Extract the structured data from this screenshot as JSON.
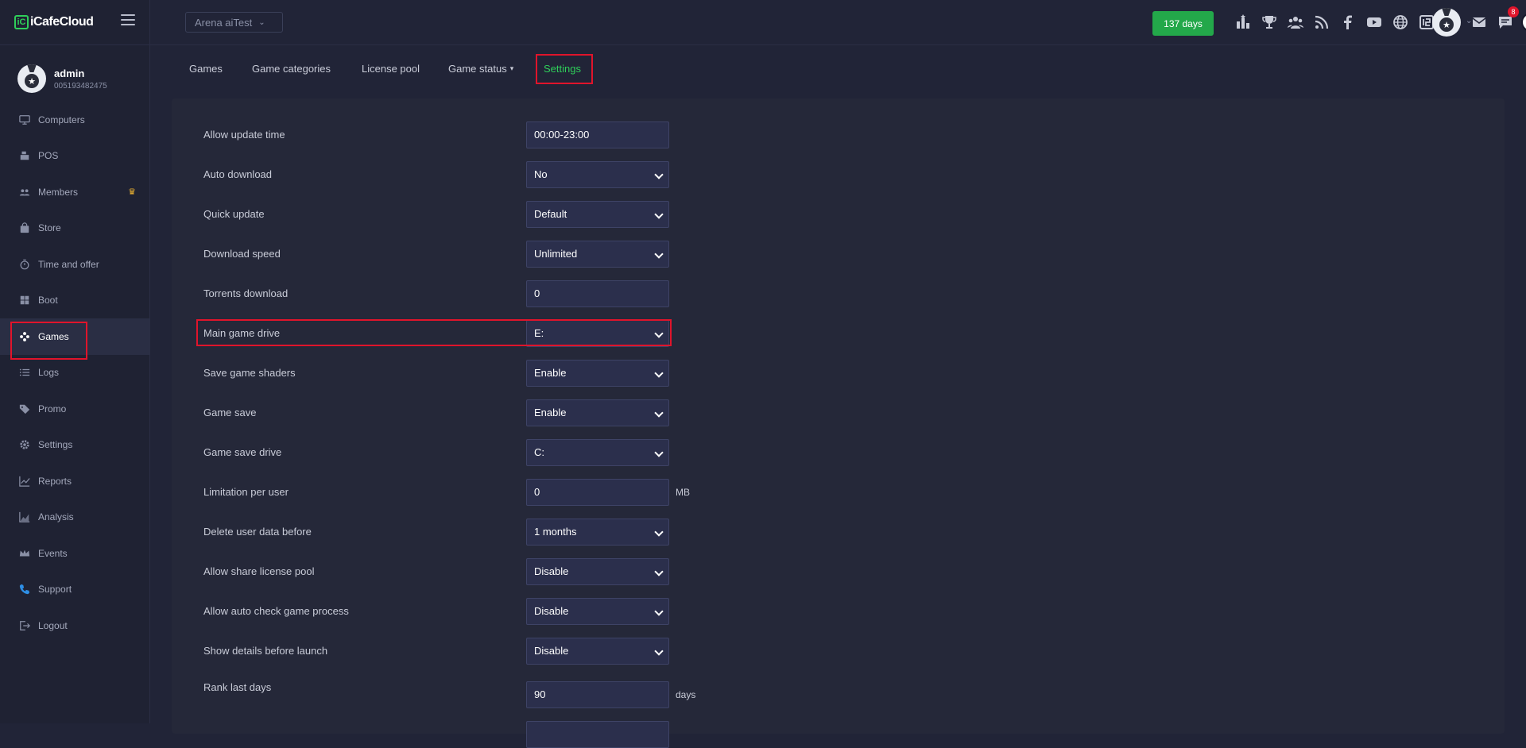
{
  "app": {
    "logo_text": "iCafeCloud"
  },
  "profile": {
    "name": "admin",
    "id": "005193482475"
  },
  "store_select": {
    "value": "Arena aiTest"
  },
  "days_button": {
    "label": "137 days"
  },
  "notifications": {
    "count": "8"
  },
  "sidebar": {
    "items": [
      {
        "label": "Computers",
        "icon": "monitor-icon"
      },
      {
        "label": "POS",
        "icon": "cash-register-icon"
      },
      {
        "label": "Members",
        "icon": "users-icon",
        "badge": "crown-icon"
      },
      {
        "label": "Store",
        "icon": "bag-icon"
      },
      {
        "label": "Time and offer",
        "icon": "stopwatch-icon"
      },
      {
        "label": "Boot",
        "icon": "windows-icon"
      },
      {
        "label": "Games",
        "icon": "gamepad-icon",
        "active": true
      },
      {
        "label": "Logs",
        "icon": "list-icon"
      },
      {
        "label": "Promo",
        "icon": "tag-icon"
      },
      {
        "label": "Settings",
        "icon": "gear-icon"
      },
      {
        "label": "Reports",
        "icon": "line-chart-icon"
      },
      {
        "label": "Analysis",
        "icon": "area-chart-icon"
      },
      {
        "label": "Events",
        "icon": "crown-outline-icon"
      },
      {
        "label": "Support",
        "icon": "phone-icon"
      },
      {
        "label": "Logout",
        "icon": "logout-icon"
      }
    ]
  },
  "tabs": [
    {
      "label": "Games"
    },
    {
      "label": "Game categories"
    },
    {
      "label": "License pool"
    },
    {
      "label": "Game status",
      "dropdown": true
    },
    {
      "label": "Settings",
      "active": true
    }
  ],
  "settings": [
    {
      "label": "Allow update time",
      "type": "input",
      "value": "00:00-23:00"
    },
    {
      "label": "Auto download",
      "type": "select",
      "value": "No"
    },
    {
      "label": "Quick update",
      "type": "select",
      "value": "Default"
    },
    {
      "label": "Download speed",
      "type": "select",
      "value": "Unlimited"
    },
    {
      "label": "Torrents download",
      "type": "input",
      "value": "0"
    },
    {
      "label": "Main game drive",
      "type": "select",
      "value": "E:",
      "highlighted": true
    },
    {
      "label": "Save game shaders",
      "type": "select",
      "value": "Enable"
    },
    {
      "label": "Game save",
      "type": "select",
      "value": "Enable"
    },
    {
      "label": "Game save drive",
      "type": "select",
      "value": "C:"
    },
    {
      "label": "Limitation per user",
      "type": "input",
      "value": "0",
      "unit": "MB"
    },
    {
      "label": "Delete user data before",
      "type": "select",
      "value": "1 months"
    },
    {
      "label": "Allow share license pool",
      "type": "select",
      "value": "Disable"
    },
    {
      "label": "Allow auto check game process",
      "type": "select",
      "value": "Disable"
    },
    {
      "label": "Show details before launch",
      "type": "select",
      "value": "Disable"
    },
    {
      "label": "Rank last days",
      "type": "input",
      "value": "90",
      "unit": "days"
    }
  ],
  "colors": {
    "accent_green": "#2fcf5a",
    "days_green": "#23a84a",
    "highlight_red": "#e0142b",
    "bg": "#212437"
  }
}
